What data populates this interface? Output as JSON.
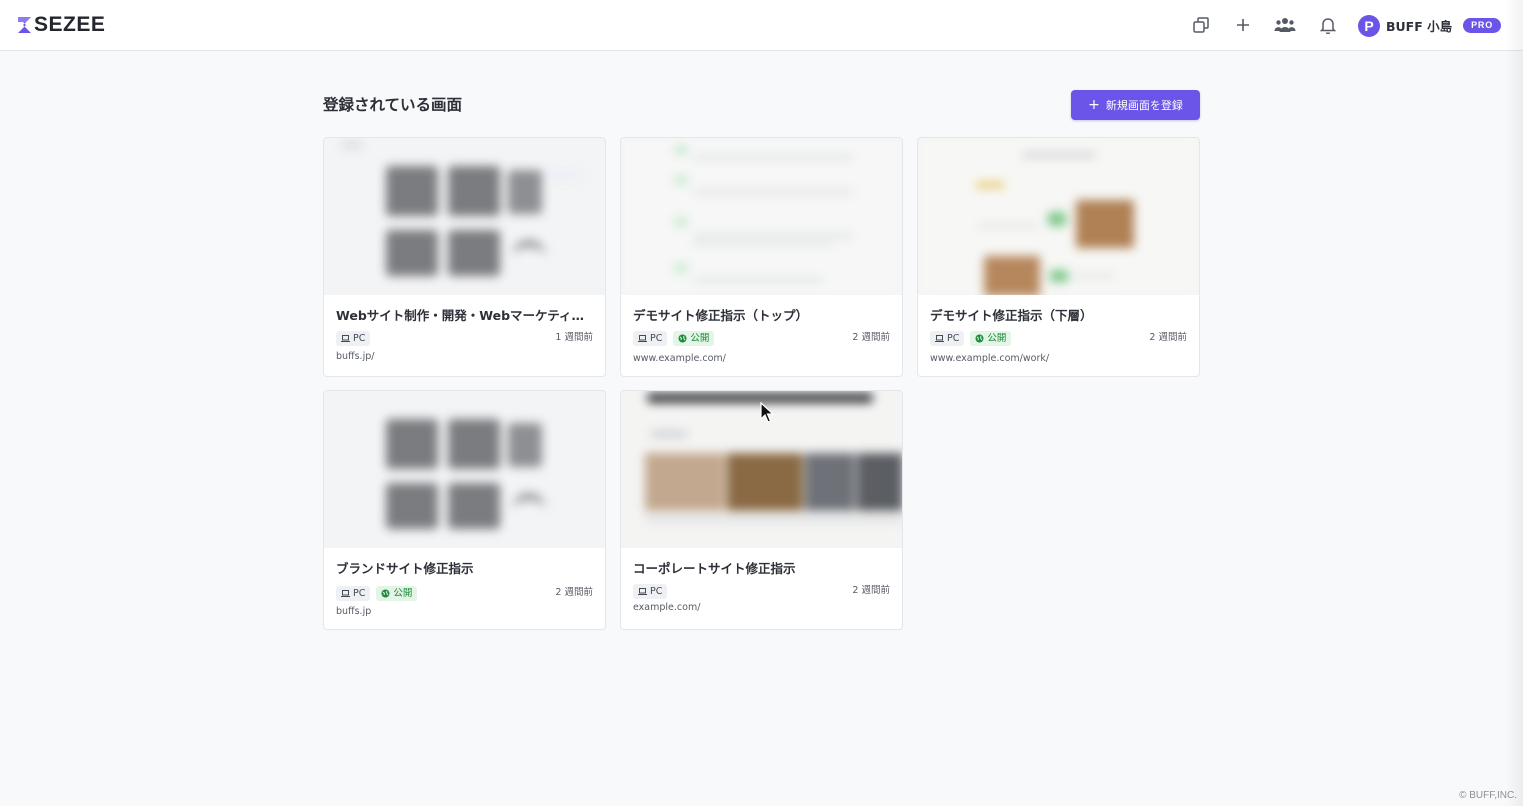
{
  "app": {
    "logo_text": "SEZEE",
    "brand_color": "#6a55e8"
  },
  "header": {
    "icons": [
      "copy-screens-icon",
      "plus-icon",
      "team-icon",
      "bell-icon"
    ],
    "user": {
      "avatar_letter": "P",
      "name": "BUFF 小島",
      "badge": "PRO"
    }
  },
  "main": {
    "title": "登録されている画面",
    "new_button": {
      "icon": "+",
      "label": "新規画面を登録"
    },
    "cards": [
      {
        "title": "Webサイト制作・開発・Webマーケティング・ブランディング",
        "device": "PC",
        "public": false,
        "public_label": "",
        "time": "1 週間前",
        "url": "buffs.jp/"
      },
      {
        "title": "デモサイト修正指示（トップ）",
        "device": "PC",
        "public": true,
        "public_label": "公開",
        "time": "2 週間前",
        "url": "www.example.com/"
      },
      {
        "title": "デモサイト修正指示（下層）",
        "device": "PC",
        "public": true,
        "public_label": "公開",
        "time": "2 週間前",
        "url": "www.example.com/work/"
      },
      {
        "title": "ブランドサイト修正指示",
        "device": "PC",
        "public": true,
        "public_label": "公開",
        "time": "2 週間前",
        "url": "buffs.jp"
      },
      {
        "title": "コーポレートサイト修正指示",
        "device": "PC",
        "public": false,
        "public_label": "",
        "time": "2 週間前",
        "url": "example.com/"
      }
    ]
  },
  "footer": {
    "copyright": "© BUFF,INC."
  }
}
